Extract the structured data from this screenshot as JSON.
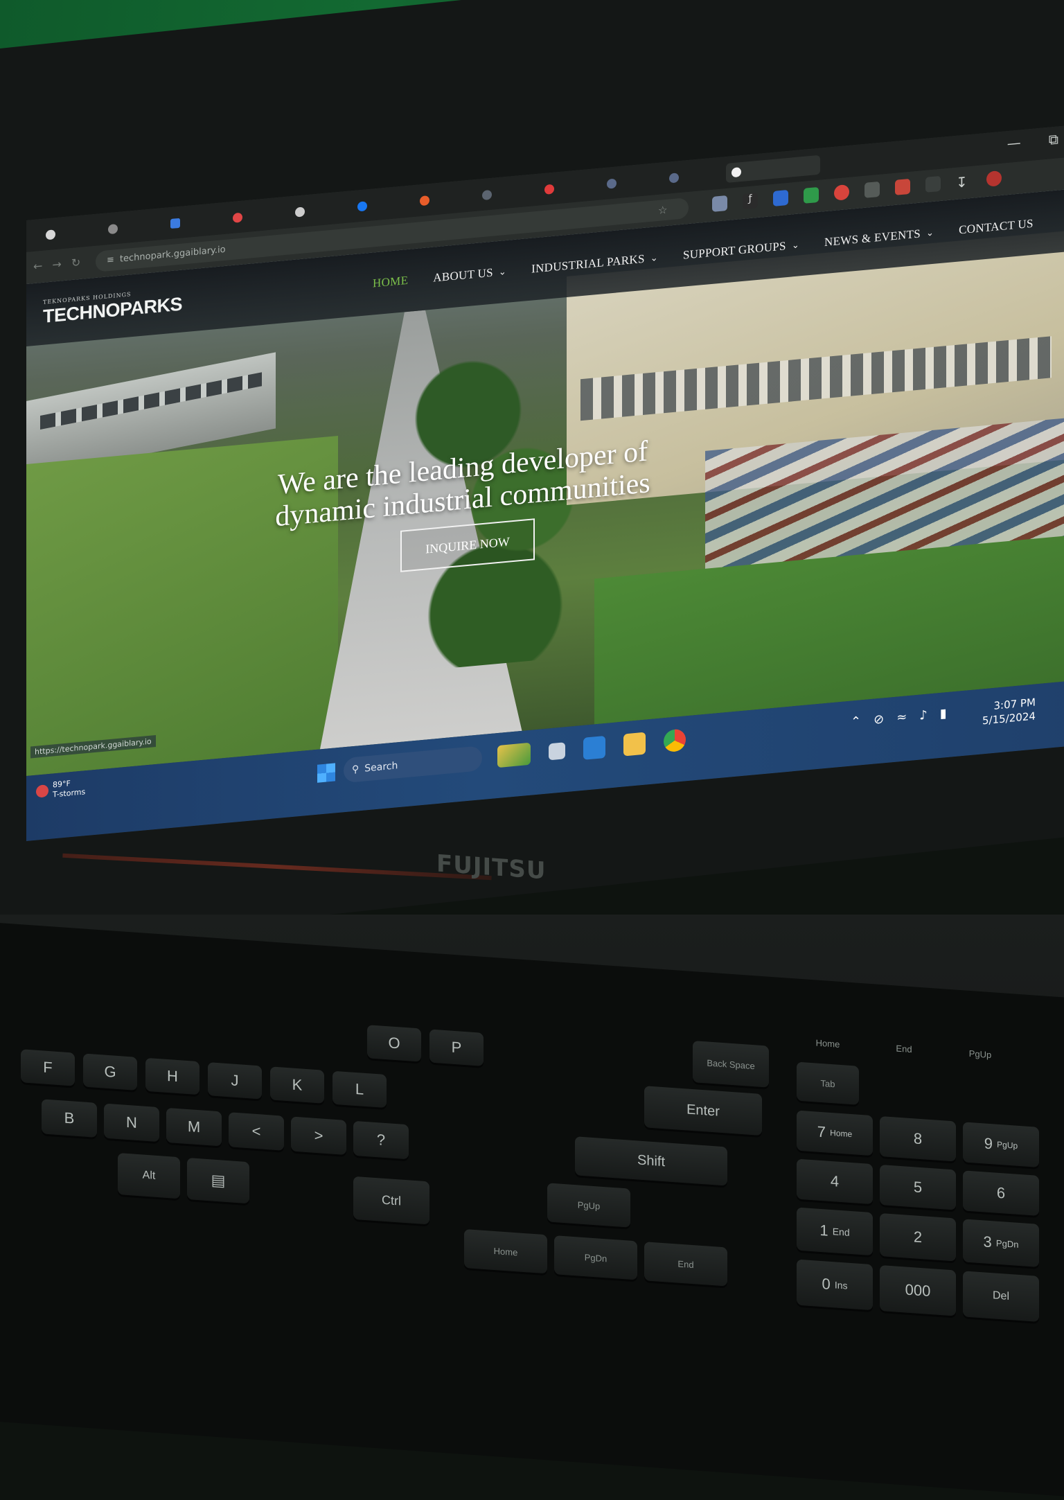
{
  "browser": {
    "url": "technopark.ggaiblary.io",
    "window_controls": [
      "—",
      "⧉"
    ]
  },
  "site": {
    "logo_small": "TEKNOPARKS HOLDINGS",
    "logo": "TECHNOPARKS",
    "nav": [
      {
        "label": "HOME",
        "active": true,
        "dropdown": false
      },
      {
        "label": "ABOUT US",
        "active": false,
        "dropdown": true
      },
      {
        "label": "INDUSTRIAL PARKS",
        "active": false,
        "dropdown": true
      },
      {
        "label": "SUPPORT GROUPS",
        "active": false,
        "dropdown": true
      },
      {
        "label": "NEWS & EVENTS",
        "active": false,
        "dropdown": true
      },
      {
        "label": "CONTACT US",
        "active": false,
        "dropdown": false
      }
    ],
    "hero": {
      "title_line1": "We are the leading developer of",
      "title_line2": "dynamic industrial communities",
      "cta": "INQUIRE NOW"
    },
    "status_url": "https://technopark.ggaiblary.io"
  },
  "taskbar": {
    "weather_line1": "89°F",
    "weather_line2": "T-storms",
    "search_placeholder": "Search",
    "clock_time": "3:07 PM",
    "clock_date": "5/15/2024"
  },
  "laptop": {
    "brand": "FUJITSU"
  },
  "keys": {
    "row_letters": [
      "G",
      "H",
      "J",
      "K",
      "L",
      "O",
      "P"
    ],
    "row_bottom": [
      "B",
      "N",
      "M"
    ],
    "backspace": "Back Space",
    "enter": "Enter",
    "shift": "Shift",
    "ctrl": "Ctrl",
    "alt": "Alt",
    "pgup": "PgUp",
    "pgdn": "PgDn",
    "home": "Home",
    "end": "End",
    "num": [
      "7",
      "8",
      "9",
      "4",
      "5",
      "6",
      "1",
      "2",
      "3",
      "0",
      "000"
    ],
    "num_sub": [
      "Home",
      "",
      "PgUp",
      "",
      "",
      "",
      "End",
      "",
      "PgDn",
      "Ins",
      ""
    ],
    "nav_top": [
      "Home",
      "End",
      "PgUp"
    ],
    "tab": "Tab",
    "del": "Del"
  },
  "colors": {
    "nav_active": "#7cc04a",
    "taskbar": "#234a7a",
    "wall": "#136a32"
  }
}
